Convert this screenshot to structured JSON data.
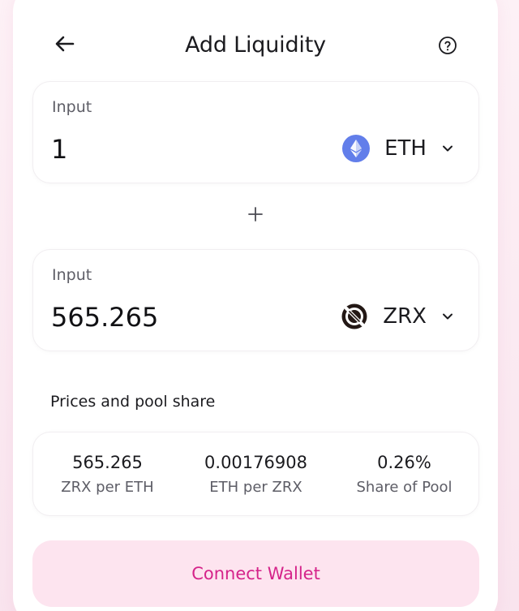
{
  "header": {
    "title": "Add Liquidity"
  },
  "inputs": [
    {
      "label": "Input",
      "value": "1",
      "token": {
        "symbol": "ETH",
        "icon": "ethereum-icon",
        "color": "#627EEA"
      }
    },
    {
      "label": "Input",
      "value": "565.265",
      "token": {
        "symbol": "ZRX",
        "icon": "zrx-icon",
        "color": "#231815"
      }
    }
  ],
  "pool": {
    "title": "Prices and pool share",
    "stats": [
      {
        "value": "565.265",
        "label": "ZRX per ETH"
      },
      {
        "value": "0.00176908",
        "label": "ETH per ZRX"
      },
      {
        "value": "0.26%",
        "label": "Share of Pool"
      }
    ]
  },
  "actions": {
    "connect_label": "Connect Wallet"
  },
  "colors": {
    "accent": "#D5238A",
    "button_bg": "#FDE4EF",
    "page_bg": "#FBE9F1"
  }
}
